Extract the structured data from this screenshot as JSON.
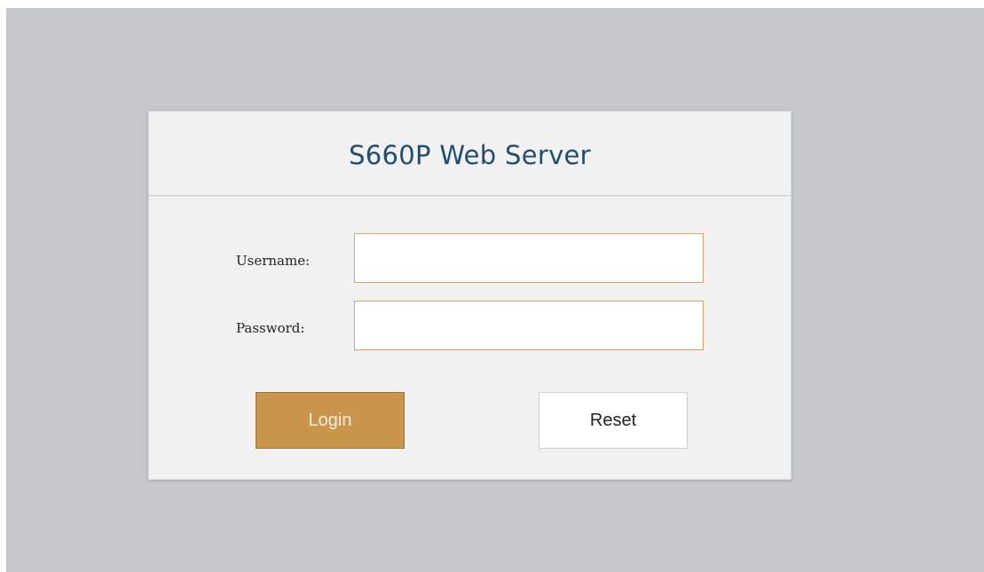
{
  "login": {
    "title": "S660P Web Server",
    "username_label": "Username:",
    "password_label": "Password:",
    "username_value": "",
    "password_value": "",
    "login_label": "Login",
    "reset_label": "Reset"
  },
  "colors": {
    "page_background": "#c4c8cb",
    "card_background": "#f1f1f1",
    "title_text": "#1f4e6e",
    "input_border": "#d9a463",
    "login_button": "#c8954a",
    "reset_button": "#ffffff"
  }
}
